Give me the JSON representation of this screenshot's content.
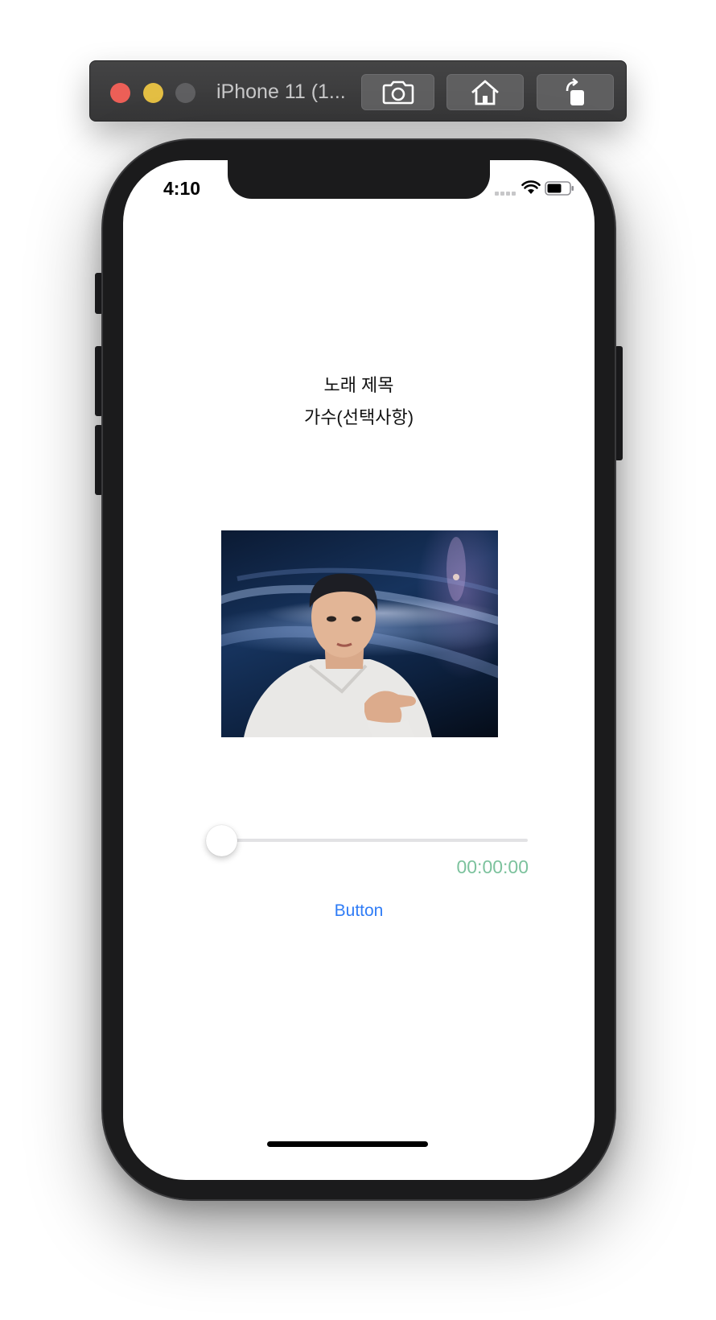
{
  "simulator": {
    "title": "iPhone 11 (1...",
    "buttons": {
      "screenshot": "camera-icon",
      "home": "home-icon",
      "rotate": "rotate-icon"
    }
  },
  "status_bar": {
    "time": "4:10",
    "icons": [
      "cellular-signal-icon",
      "wifi-icon",
      "battery-icon"
    ]
  },
  "player": {
    "song_title": "노래 제목",
    "singer": "가수(선택사항)",
    "album_art": "album-art-image",
    "progress_fraction": 0,
    "elapsed_time": "00:00:00",
    "button_label": "Button"
  },
  "colors": {
    "accent": "#2f7cf6",
    "time_label": "#7cc29d",
    "close": "#ec5f57",
    "minimize": "#e3be43",
    "zoom": "#5f5f61"
  }
}
